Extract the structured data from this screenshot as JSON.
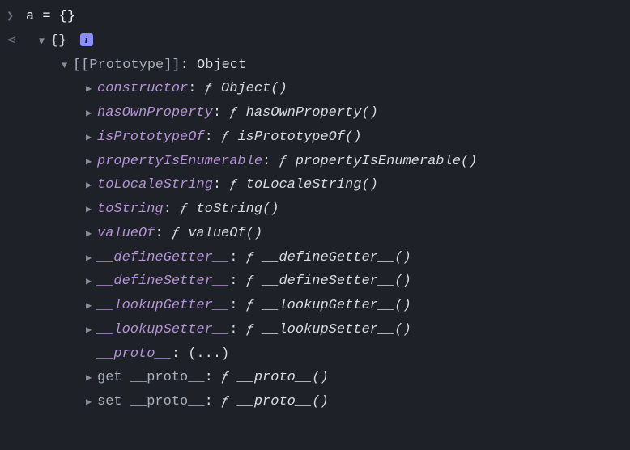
{
  "input": {
    "prompt_marker": "❯",
    "code": "a = {}"
  },
  "output": {
    "return_marker": "⋖",
    "preview": "{}",
    "info_badge": "i",
    "prototype_label": "[[Prototype]]",
    "prototype_value": "Object",
    "props": [
      {
        "key": "constructor",
        "f": "ƒ",
        "fn": "Object()",
        "arrow": true,
        "key_style": "purple"
      },
      {
        "key": "hasOwnProperty",
        "f": "ƒ",
        "fn": "hasOwnProperty()",
        "arrow": true,
        "key_style": "purple"
      },
      {
        "key": "isPrototypeOf",
        "f": "ƒ",
        "fn": "isPrototypeOf()",
        "arrow": true,
        "key_style": "purple"
      },
      {
        "key": "propertyIsEnumerable",
        "f": "ƒ",
        "fn": "propertyIsEnumerable()",
        "arrow": true,
        "key_style": "purple"
      },
      {
        "key": "toLocaleString",
        "f": "ƒ",
        "fn": "toLocaleString()",
        "arrow": true,
        "key_style": "purple"
      },
      {
        "key": "toString",
        "f": "ƒ",
        "fn": "toString()",
        "arrow": true,
        "key_style": "purple"
      },
      {
        "key": "valueOf",
        "f": "ƒ",
        "fn": "valueOf()",
        "arrow": true,
        "key_style": "purple"
      },
      {
        "key": "__defineGetter__",
        "f": "ƒ",
        "fn": "__defineGetter__()",
        "arrow": true,
        "key_style": "purple"
      },
      {
        "key": "__defineSetter__",
        "f": "ƒ",
        "fn": "__defineSetter__()",
        "arrow": true,
        "key_style": "purple"
      },
      {
        "key": "__lookupGetter__",
        "f": "ƒ",
        "fn": "__lookupGetter__()",
        "arrow": true,
        "key_style": "purple"
      },
      {
        "key": "__lookupSetter__",
        "f": "ƒ",
        "fn": "__lookupSetter__()",
        "arrow": true,
        "key_style": "purple"
      },
      {
        "key": "__proto__",
        "f": "",
        "fn": "(...)",
        "arrow": false,
        "key_style": "purple"
      },
      {
        "key": "get __proto__",
        "f": "ƒ",
        "fn": "__proto__()",
        "arrow": true,
        "key_style": "dim"
      },
      {
        "key": "set __proto__",
        "f": "ƒ",
        "fn": "__proto__()",
        "arrow": true,
        "key_style": "dim"
      }
    ]
  }
}
